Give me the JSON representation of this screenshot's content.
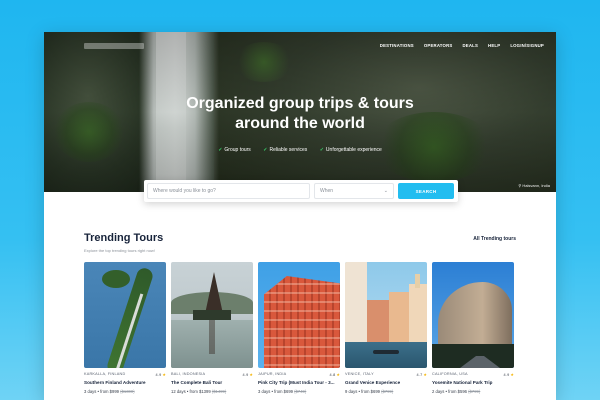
{
  "nav": {
    "items": [
      "DESTINATIONS",
      "OPERATORS",
      "DEALS",
      "HELP",
      "LOGIN/SIGNUP"
    ]
  },
  "hero": {
    "title_line1": "Organized group trips & tours",
    "title_line2": "around the world",
    "features": [
      "Group tours",
      "Reliable services",
      "Unforgettable experience"
    ],
    "credit": "Halsvann, India"
  },
  "search": {
    "placeholder": "Where would you like to go?",
    "when_placeholder": "When",
    "button_label": "SEARCH"
  },
  "trending": {
    "title": "Trending Tours",
    "subtitle": "Explore the top trending tours right now!",
    "all_link": "All Trending tours",
    "tours": [
      {
        "location": "KARKALLA, FINLAND",
        "rating": "4.9",
        "name": "Southern Finland Adventure",
        "days": "3 days",
        "price": "from $999",
        "old_price": "($1300)"
      },
      {
        "location": "BALI, INDONESIA",
        "rating": "4.9",
        "name": "The Complete Bali Tour",
        "days": "12 days",
        "price": "from $1399",
        "old_price": "($1499)"
      },
      {
        "location": "JAIPUR, INDIA",
        "rating": "4.8",
        "name": "Pink City Trip (Must India Tour - 3...",
        "days": "3 days",
        "price": "from $699",
        "old_price": "($749)"
      },
      {
        "location": "VENICE, ITALY",
        "rating": "4.7",
        "name": "Grand Venice Experience",
        "days": "9 days",
        "price": "from $699",
        "old_price": "($799)"
      },
      {
        "location": "CALIFORNIA, USA",
        "rating": "4.9",
        "name": "Yosemite National Park Trip",
        "days": "2 days",
        "price": "from $596",
        "old_price": "($799)"
      }
    ]
  },
  "colors": {
    "accent": "#22bdf0",
    "star": "#f5b301",
    "check": "#3ad36b",
    "background": "#1fb6f0"
  },
  "icons": {
    "check": "check-icon",
    "star": "star-icon",
    "chevron": "chevron-down-icon",
    "location": "map-pin-icon"
  }
}
